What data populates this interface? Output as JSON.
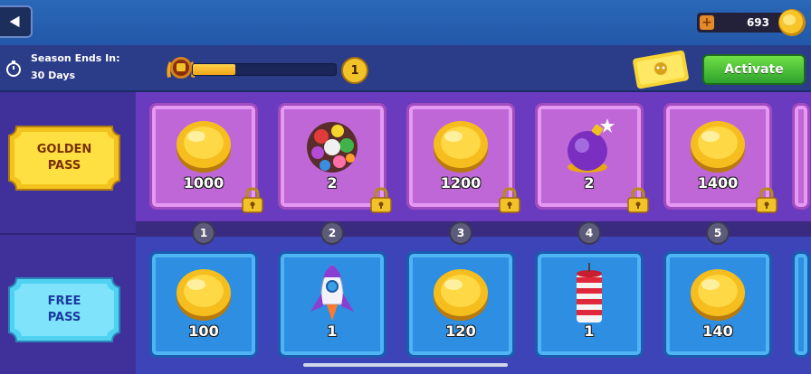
{
  "header": {
    "coins": "693"
  },
  "season": {
    "label": "Season Ends In:",
    "days": "30 Days",
    "level": "1",
    "progress": 0.3,
    "activate_label": "Activate"
  },
  "passes": {
    "golden_label": "GOLDEN\nPASS",
    "free_label": "FREE\nPASS"
  },
  "levels": [
    "1",
    "2",
    "3",
    "4",
    "5"
  ],
  "golden_rewards": [
    {
      "icon": "coin-icon",
      "value": "1000"
    },
    {
      "icon": "candy-ball-icon",
      "value": "2"
    },
    {
      "icon": "coin-icon",
      "value": "1200"
    },
    {
      "icon": "bomb-icon",
      "value": "2"
    },
    {
      "icon": "coin-icon",
      "value": "1400"
    }
  ],
  "free_rewards": [
    {
      "icon": "coin-icon",
      "value": "100"
    },
    {
      "icon": "rocket-icon",
      "value": "1"
    },
    {
      "icon": "coin-icon",
      "value": "120"
    },
    {
      "icon": "firework-icon",
      "value": "1"
    },
    {
      "icon": "coin-icon",
      "value": "140"
    }
  ],
  "colors": {
    "accent": "#2ea22c",
    "gold": "#f2c229",
    "golden_row": "#c067d8",
    "free_row": "#2d8ee2"
  }
}
